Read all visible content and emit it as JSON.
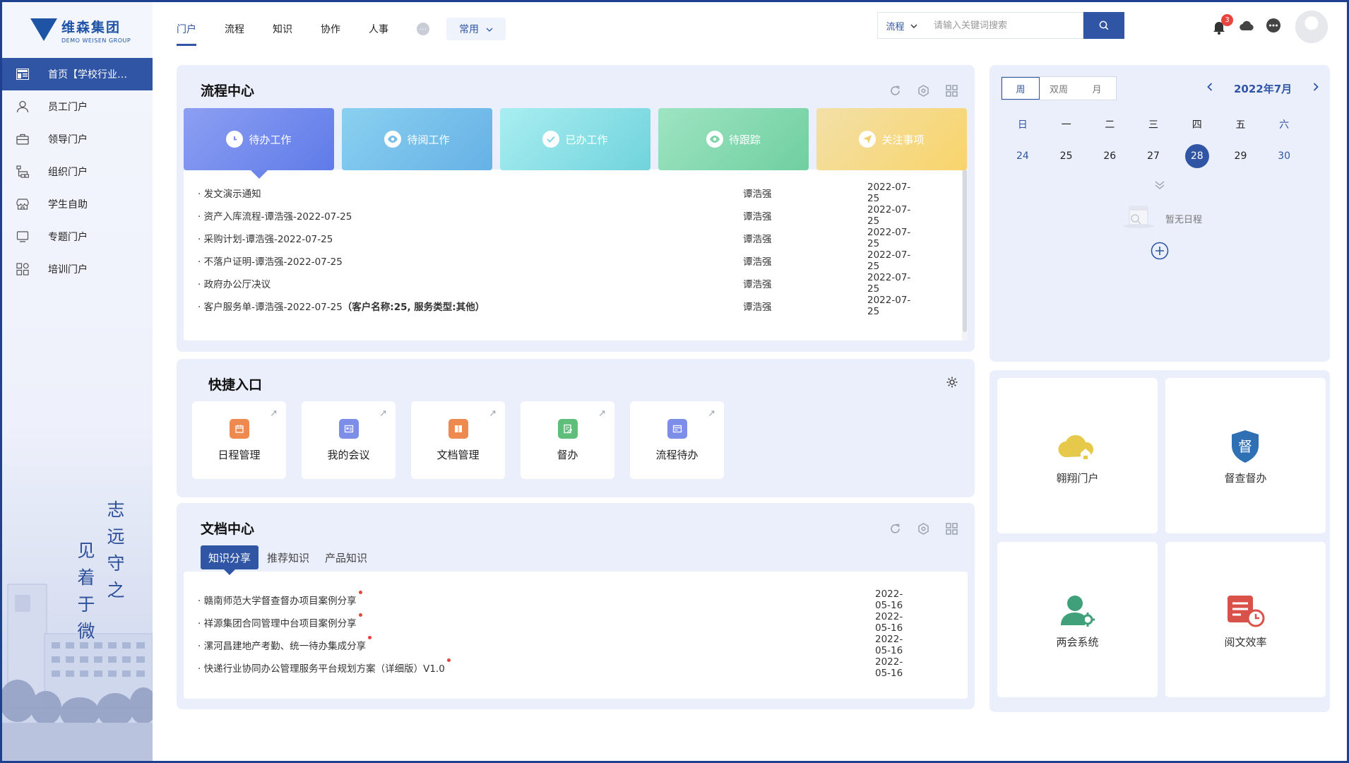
{
  "brand": {
    "name_cn": "维森集团",
    "name_en": "DEMO WEISEN GROUP"
  },
  "sidebar": {
    "items": [
      {
        "label": "首页【学校行业…",
        "icon": "home-grid-icon",
        "active": true
      },
      {
        "label": "员工门户",
        "icon": "user-icon"
      },
      {
        "label": "领导门户",
        "icon": "briefcase-icon"
      },
      {
        "label": "组织门户",
        "icon": "org-chart-icon"
      },
      {
        "label": "学生自助",
        "icon": "storefront-icon"
      },
      {
        "label": "专题门户",
        "icon": "monitor-icon"
      },
      {
        "label": "培训门户",
        "icon": "apps-icon"
      }
    ],
    "calligraphy": [
      "志",
      "远",
      "守",
      "之",
      "见",
      "着",
      "于",
      "微"
    ]
  },
  "topnav": {
    "tabs": [
      "门户",
      "流程",
      "知识",
      "协作",
      "人事"
    ],
    "active_tab": "门户",
    "more_icon": "ellipsis-icon",
    "common_label": "常用"
  },
  "search": {
    "type": "流程",
    "placeholder": "请输入关键词搜索"
  },
  "notifications": {
    "count": "3"
  },
  "flow_center": {
    "title": "流程中心",
    "tabs": [
      {
        "label": "待办工作",
        "icon": "clock-icon",
        "color_from": "#8c9ff2",
        "color_to": "#5f7be8"
      },
      {
        "label": "待阅工作",
        "icon": "eye-icon",
        "color_from": "#8ad0f0",
        "color_to": "#66b1e6"
      },
      {
        "label": "已办工作",
        "icon": "check-icon",
        "color_from": "#a9eef1",
        "color_to": "#70d3dc"
      },
      {
        "label": "待跟踪",
        "icon": "eye-icon",
        "color_from": "#9ee4c3",
        "color_to": "#6fcf9f"
      },
      {
        "label": "关注事项",
        "icon": "send-icon",
        "color_from": "#f3e0a8",
        "color_to": "#f8d46a"
      }
    ],
    "rows": [
      {
        "title": "发文演示通知",
        "person": "谭浩强",
        "date": "2022-07-25"
      },
      {
        "title": "资产入库流程-谭浩强-2022-07-25",
        "person": "谭浩强",
        "date": "2022-07-25"
      },
      {
        "title": "采购计划-谭浩强-2022-07-25",
        "person": "谭浩强",
        "date": "2022-07-25"
      },
      {
        "title": "不落户证明-谭浩强-2022-07-25",
        "person": "谭浩强",
        "date": "2022-07-25"
      },
      {
        "title": "政府办公厅决议",
        "person": "谭浩强",
        "date": "2022-07-25"
      },
      {
        "title": "客户服务单-谭浩强-2022-07-25",
        "title_bold": "（客户名称:25, 服务类型:其他）",
        "person": "谭浩强",
        "date": "2022-07-25"
      }
    ]
  },
  "quick_entry": {
    "title": "快捷入口",
    "items": [
      {
        "label": "日程管理",
        "icon": "calendar-icon",
        "color": "#ee8a4f"
      },
      {
        "label": "我的会议",
        "icon": "meeting-icon",
        "color": "#7d8ee8"
      },
      {
        "label": "文档管理",
        "icon": "book-icon",
        "color": "#ee8a4f"
      },
      {
        "label": "督办",
        "icon": "edit-doc-icon",
        "color": "#5fbf7a"
      },
      {
        "label": "流程待办",
        "icon": "card-icon",
        "color": "#7d8ee8"
      }
    ]
  },
  "doc_center": {
    "title": "文档中心",
    "tabs": [
      "知识分享",
      "推荐知识",
      "产品知识"
    ],
    "rows": [
      {
        "title": "赣南师范大学督查督办项目案例分享",
        "date": "2022-05-16"
      },
      {
        "title": "祥源集团合同管理中台项目案例分享",
        "date": "2022-05-16"
      },
      {
        "title": "漯河昌建地产考勤、统一待办集成分享",
        "date": "2022-05-16"
      },
      {
        "title": "快递行业协同办公管理服务平台规划方案（详细版）V1.0",
        "date": "2022-05-16"
      }
    ]
  },
  "calendar": {
    "views": [
      "周",
      "双周",
      "月"
    ],
    "active_view": "周",
    "month": "2022年7月",
    "weekdays": [
      "日",
      "一",
      "二",
      "三",
      "四",
      "五",
      "六"
    ],
    "days": [
      "24",
      "25",
      "26",
      "27",
      "28",
      "29",
      "30"
    ],
    "today": "28",
    "empty_text": "暂无日程"
  },
  "apps": [
    {
      "label": "翱翔门户",
      "icon": "cloud-home-icon",
      "color": "#e6c84a"
    },
    {
      "label": "督查督办",
      "icon": "shield-du-icon",
      "color": "#2f6fb4"
    },
    {
      "label": "两会系统",
      "icon": "user-gear-icon",
      "color": "#3fa07a"
    },
    {
      "label": "阅文效率",
      "icon": "doc-clock-icon",
      "color": "#d9524a"
    }
  ],
  "colors": {
    "primary": "#2f55a4",
    "panel": "#ebeffb",
    "badge": "#e5453e"
  }
}
